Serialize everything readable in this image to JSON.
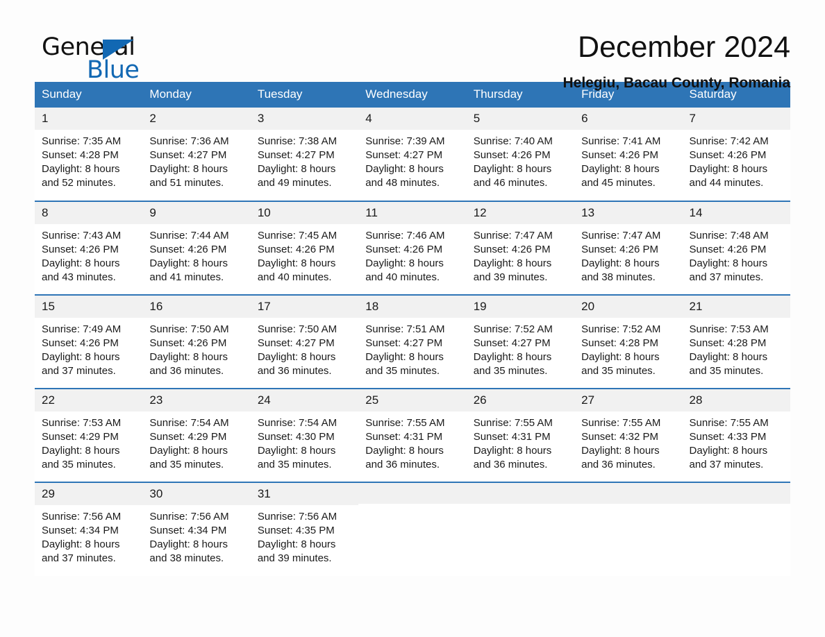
{
  "brand": {
    "name_part1": "General",
    "name_part2": "Blue"
  },
  "header": {
    "title": "December 2024",
    "location": "Helegiu, Bacau County, Romania"
  },
  "calendar": {
    "weekday_headers": [
      "Sunday",
      "Monday",
      "Tuesday",
      "Wednesday",
      "Thursday",
      "Friday",
      "Saturday"
    ],
    "colors": {
      "header_background": "#2e75b6",
      "header_text": "#ffffff",
      "daynum_background": "#f1f1f1",
      "row_divider": "#2e75b6",
      "brand_blue": "#1268b3"
    },
    "labels": {
      "sunrise_prefix": "Sunrise:",
      "sunset_prefix": "Sunset:",
      "daylight_prefix": "Daylight:"
    },
    "weeks": [
      [
        {
          "day": "1",
          "sunrise": "Sunrise: 7:35 AM",
          "sunset": "Sunset: 4:28 PM",
          "daylight_line1": "Daylight: 8 hours",
          "daylight_line2": "and 52 minutes."
        },
        {
          "day": "2",
          "sunrise": "Sunrise: 7:36 AM",
          "sunset": "Sunset: 4:27 PM",
          "daylight_line1": "Daylight: 8 hours",
          "daylight_line2": "and 51 minutes."
        },
        {
          "day": "3",
          "sunrise": "Sunrise: 7:38 AM",
          "sunset": "Sunset: 4:27 PM",
          "daylight_line1": "Daylight: 8 hours",
          "daylight_line2": "and 49 minutes."
        },
        {
          "day": "4",
          "sunrise": "Sunrise: 7:39 AM",
          "sunset": "Sunset: 4:27 PM",
          "daylight_line1": "Daylight: 8 hours",
          "daylight_line2": "and 48 minutes."
        },
        {
          "day": "5",
          "sunrise": "Sunrise: 7:40 AM",
          "sunset": "Sunset: 4:26 PM",
          "daylight_line1": "Daylight: 8 hours",
          "daylight_line2": "and 46 minutes."
        },
        {
          "day": "6",
          "sunrise": "Sunrise: 7:41 AM",
          "sunset": "Sunset: 4:26 PM",
          "daylight_line1": "Daylight: 8 hours",
          "daylight_line2": "and 45 minutes."
        },
        {
          "day": "7",
          "sunrise": "Sunrise: 7:42 AM",
          "sunset": "Sunset: 4:26 PM",
          "daylight_line1": "Daylight: 8 hours",
          "daylight_line2": "and 44 minutes."
        }
      ],
      [
        {
          "day": "8",
          "sunrise": "Sunrise: 7:43 AM",
          "sunset": "Sunset: 4:26 PM",
          "daylight_line1": "Daylight: 8 hours",
          "daylight_line2": "and 43 minutes."
        },
        {
          "day": "9",
          "sunrise": "Sunrise: 7:44 AM",
          "sunset": "Sunset: 4:26 PM",
          "daylight_line1": "Daylight: 8 hours",
          "daylight_line2": "and 41 minutes."
        },
        {
          "day": "10",
          "sunrise": "Sunrise: 7:45 AM",
          "sunset": "Sunset: 4:26 PM",
          "daylight_line1": "Daylight: 8 hours",
          "daylight_line2": "and 40 minutes."
        },
        {
          "day": "11",
          "sunrise": "Sunrise: 7:46 AM",
          "sunset": "Sunset: 4:26 PM",
          "daylight_line1": "Daylight: 8 hours",
          "daylight_line2": "and 40 minutes."
        },
        {
          "day": "12",
          "sunrise": "Sunrise: 7:47 AM",
          "sunset": "Sunset: 4:26 PM",
          "daylight_line1": "Daylight: 8 hours",
          "daylight_line2": "and 39 minutes."
        },
        {
          "day": "13",
          "sunrise": "Sunrise: 7:47 AM",
          "sunset": "Sunset: 4:26 PM",
          "daylight_line1": "Daylight: 8 hours",
          "daylight_line2": "and 38 minutes."
        },
        {
          "day": "14",
          "sunrise": "Sunrise: 7:48 AM",
          "sunset": "Sunset: 4:26 PM",
          "daylight_line1": "Daylight: 8 hours",
          "daylight_line2": "and 37 minutes."
        }
      ],
      [
        {
          "day": "15",
          "sunrise": "Sunrise: 7:49 AM",
          "sunset": "Sunset: 4:26 PM",
          "daylight_line1": "Daylight: 8 hours",
          "daylight_line2": "and 37 minutes."
        },
        {
          "day": "16",
          "sunrise": "Sunrise: 7:50 AM",
          "sunset": "Sunset: 4:26 PM",
          "daylight_line1": "Daylight: 8 hours",
          "daylight_line2": "and 36 minutes."
        },
        {
          "day": "17",
          "sunrise": "Sunrise: 7:50 AM",
          "sunset": "Sunset: 4:27 PM",
          "daylight_line1": "Daylight: 8 hours",
          "daylight_line2": "and 36 minutes."
        },
        {
          "day": "18",
          "sunrise": "Sunrise: 7:51 AM",
          "sunset": "Sunset: 4:27 PM",
          "daylight_line1": "Daylight: 8 hours",
          "daylight_line2": "and 35 minutes."
        },
        {
          "day": "19",
          "sunrise": "Sunrise: 7:52 AM",
          "sunset": "Sunset: 4:27 PM",
          "daylight_line1": "Daylight: 8 hours",
          "daylight_line2": "and 35 minutes."
        },
        {
          "day": "20",
          "sunrise": "Sunrise: 7:52 AM",
          "sunset": "Sunset: 4:28 PM",
          "daylight_line1": "Daylight: 8 hours",
          "daylight_line2": "and 35 minutes."
        },
        {
          "day": "21",
          "sunrise": "Sunrise: 7:53 AM",
          "sunset": "Sunset: 4:28 PM",
          "daylight_line1": "Daylight: 8 hours",
          "daylight_line2": "and 35 minutes."
        }
      ],
      [
        {
          "day": "22",
          "sunrise": "Sunrise: 7:53 AM",
          "sunset": "Sunset: 4:29 PM",
          "daylight_line1": "Daylight: 8 hours",
          "daylight_line2": "and 35 minutes."
        },
        {
          "day": "23",
          "sunrise": "Sunrise: 7:54 AM",
          "sunset": "Sunset: 4:29 PM",
          "daylight_line1": "Daylight: 8 hours",
          "daylight_line2": "and 35 minutes."
        },
        {
          "day": "24",
          "sunrise": "Sunrise: 7:54 AM",
          "sunset": "Sunset: 4:30 PM",
          "daylight_line1": "Daylight: 8 hours",
          "daylight_line2": "and 35 minutes."
        },
        {
          "day": "25",
          "sunrise": "Sunrise: 7:55 AM",
          "sunset": "Sunset: 4:31 PM",
          "daylight_line1": "Daylight: 8 hours",
          "daylight_line2": "and 36 minutes."
        },
        {
          "day": "26",
          "sunrise": "Sunrise: 7:55 AM",
          "sunset": "Sunset: 4:31 PM",
          "daylight_line1": "Daylight: 8 hours",
          "daylight_line2": "and 36 minutes."
        },
        {
          "day": "27",
          "sunrise": "Sunrise: 7:55 AM",
          "sunset": "Sunset: 4:32 PM",
          "daylight_line1": "Daylight: 8 hours",
          "daylight_line2": "and 36 minutes."
        },
        {
          "day": "28",
          "sunrise": "Sunrise: 7:55 AM",
          "sunset": "Sunset: 4:33 PM",
          "daylight_line1": "Daylight: 8 hours",
          "daylight_line2": "and 37 minutes."
        }
      ],
      [
        {
          "day": "29",
          "sunrise": "Sunrise: 7:56 AM",
          "sunset": "Sunset: 4:34 PM",
          "daylight_line1": "Daylight: 8 hours",
          "daylight_line2": "and 37 minutes."
        },
        {
          "day": "30",
          "sunrise": "Sunrise: 7:56 AM",
          "sunset": "Sunset: 4:34 PM",
          "daylight_line1": "Daylight: 8 hours",
          "daylight_line2": "and 38 minutes."
        },
        {
          "day": "31",
          "sunrise": "Sunrise: 7:56 AM",
          "sunset": "Sunset: 4:35 PM",
          "daylight_line1": "Daylight: 8 hours",
          "daylight_line2": "and 39 minutes."
        },
        {
          "day": "",
          "sunrise": "",
          "sunset": "",
          "daylight_line1": "",
          "daylight_line2": "",
          "empty": true
        },
        {
          "day": "",
          "sunrise": "",
          "sunset": "",
          "daylight_line1": "",
          "daylight_line2": "",
          "empty": true
        },
        {
          "day": "",
          "sunrise": "",
          "sunset": "",
          "daylight_line1": "",
          "daylight_line2": "",
          "empty": true
        },
        {
          "day": "",
          "sunrise": "",
          "sunset": "",
          "daylight_line1": "",
          "daylight_line2": "",
          "empty": true
        }
      ]
    ]
  }
}
